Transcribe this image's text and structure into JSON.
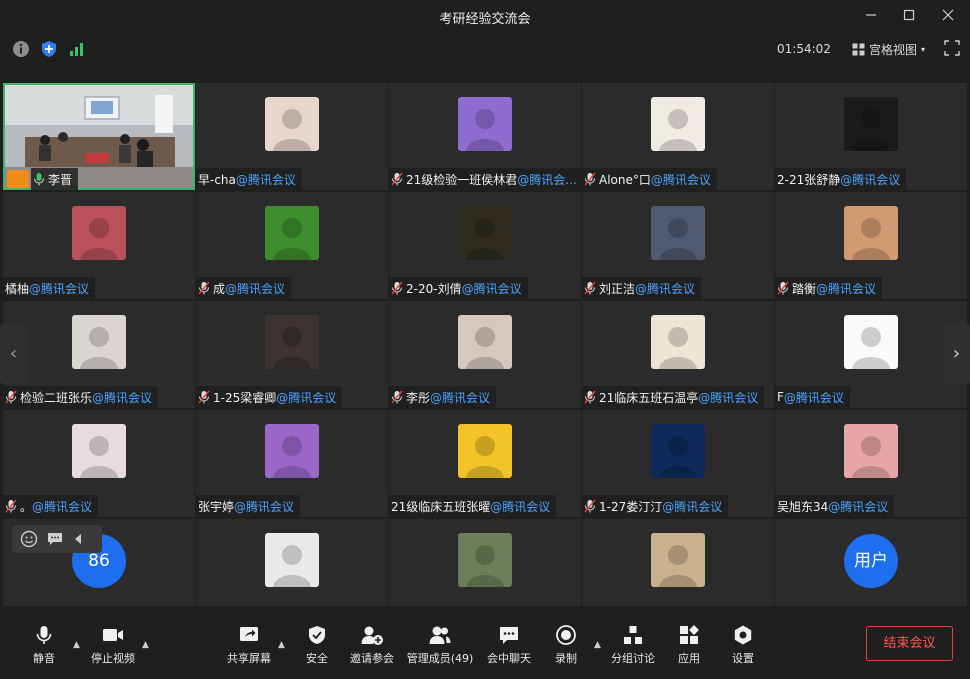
{
  "window": {
    "title": "考研经验交流会"
  },
  "infobar": {
    "timer": "01:54:02",
    "view_label": "宫格视图"
  },
  "suffix": "@腾讯会议",
  "tiles": [
    {
      "name": "李晋",
      "suffix": "",
      "mic": "on",
      "kind": "video"
    },
    {
      "name": "早-cha",
      "mic": "none",
      "kind": "photo",
      "bg": "#e7d6cc"
    },
    {
      "name": "21级检验一班侯林君",
      "suffix": "@腾讯会...",
      "mic": "muted",
      "kind": "photo",
      "bg": "#8e6ccf"
    },
    {
      "name": "Alone°口",
      "mic": "muted",
      "kind": "photo",
      "bg": "#f0ebe4"
    },
    {
      "name": "2-21张舒静",
      "mic": "none",
      "kind": "photo",
      "bg": "#1a1a1a"
    },
    {
      "name": "橘柚",
      "mic": "none",
      "kind": "photo",
      "bg": "#b9505a"
    },
    {
      "name": "成",
      "mic": "muted",
      "kind": "photo",
      "bg": "#3e8d2c"
    },
    {
      "name": "2-20-刘倩",
      "mic": "muted",
      "kind": "photo",
      "bg": "#2d2c1f"
    },
    {
      "name": "刘正洁",
      "mic": "muted",
      "kind": "photo",
      "bg": "#4f5a70"
    },
    {
      "name": "踏衡",
      "mic": "muted",
      "kind": "photo",
      "bg": "#d29a72"
    },
    {
      "name": "检验二班张乐",
      "mic": "muted",
      "kind": "photo",
      "bg": "#d9d6d2"
    },
    {
      "name": "1-25梁睿卿",
      "mic": "muted",
      "kind": "photo",
      "bg": "#3b3430"
    },
    {
      "name": "李彤",
      "mic": "muted",
      "kind": "photo",
      "bg": "#d6c8bf"
    },
    {
      "name": "21临床五班石温亭",
      "mic": "muted",
      "kind": "photo",
      "bg": "#efe5d6"
    },
    {
      "name": "F",
      "mic": "none",
      "kind": "photo",
      "bg": "#fafafa"
    },
    {
      "name": "。",
      "mic": "muted",
      "kind": "photo",
      "bg": "#e6dcdf"
    },
    {
      "name": "张宇婷",
      "mic": "none",
      "kind": "photo",
      "bg": "#9a67c9"
    },
    {
      "name": "21级临床五班张曜",
      "mic": "none",
      "kind": "photo",
      "bg": "#f2c428"
    },
    {
      "name": "1-27娄汀汀",
      "mic": "muted",
      "kind": "photo",
      "bg": "#0e2a5a"
    },
    {
      "name": "吴旭东34",
      "mic": "none",
      "kind": "photo",
      "bg": "#e8a6a6"
    },
    {
      "name": "86",
      "mic": "none",
      "kind": "circle"
    },
    {
      "name": "",
      "mic": "none",
      "kind": "photo",
      "bg": "#e9e9e9"
    },
    {
      "name": "",
      "mic": "none",
      "kind": "photo",
      "bg": "#6f7e5a"
    },
    {
      "name": "",
      "mic": "none",
      "kind": "photo",
      "bg": "#c9b18e"
    },
    {
      "name": "用户",
      "mic": "none",
      "kind": "circle"
    }
  ],
  "toolbar": {
    "mute": "静音",
    "stop_video": "停止视频",
    "share": "共享屏幕",
    "security": "安全",
    "invite": "邀请参会",
    "members": "管理成员(49)",
    "chat": "会中聊天",
    "record": "录制",
    "breakout": "分组讨论",
    "apps": "应用",
    "settings": "设置",
    "end": "结束会议"
  },
  "colors": {
    "accent": "#1e6ff0",
    "danger": "#e0433c",
    "link": "#4aa3ff",
    "active_border": "#3fb36b"
  }
}
